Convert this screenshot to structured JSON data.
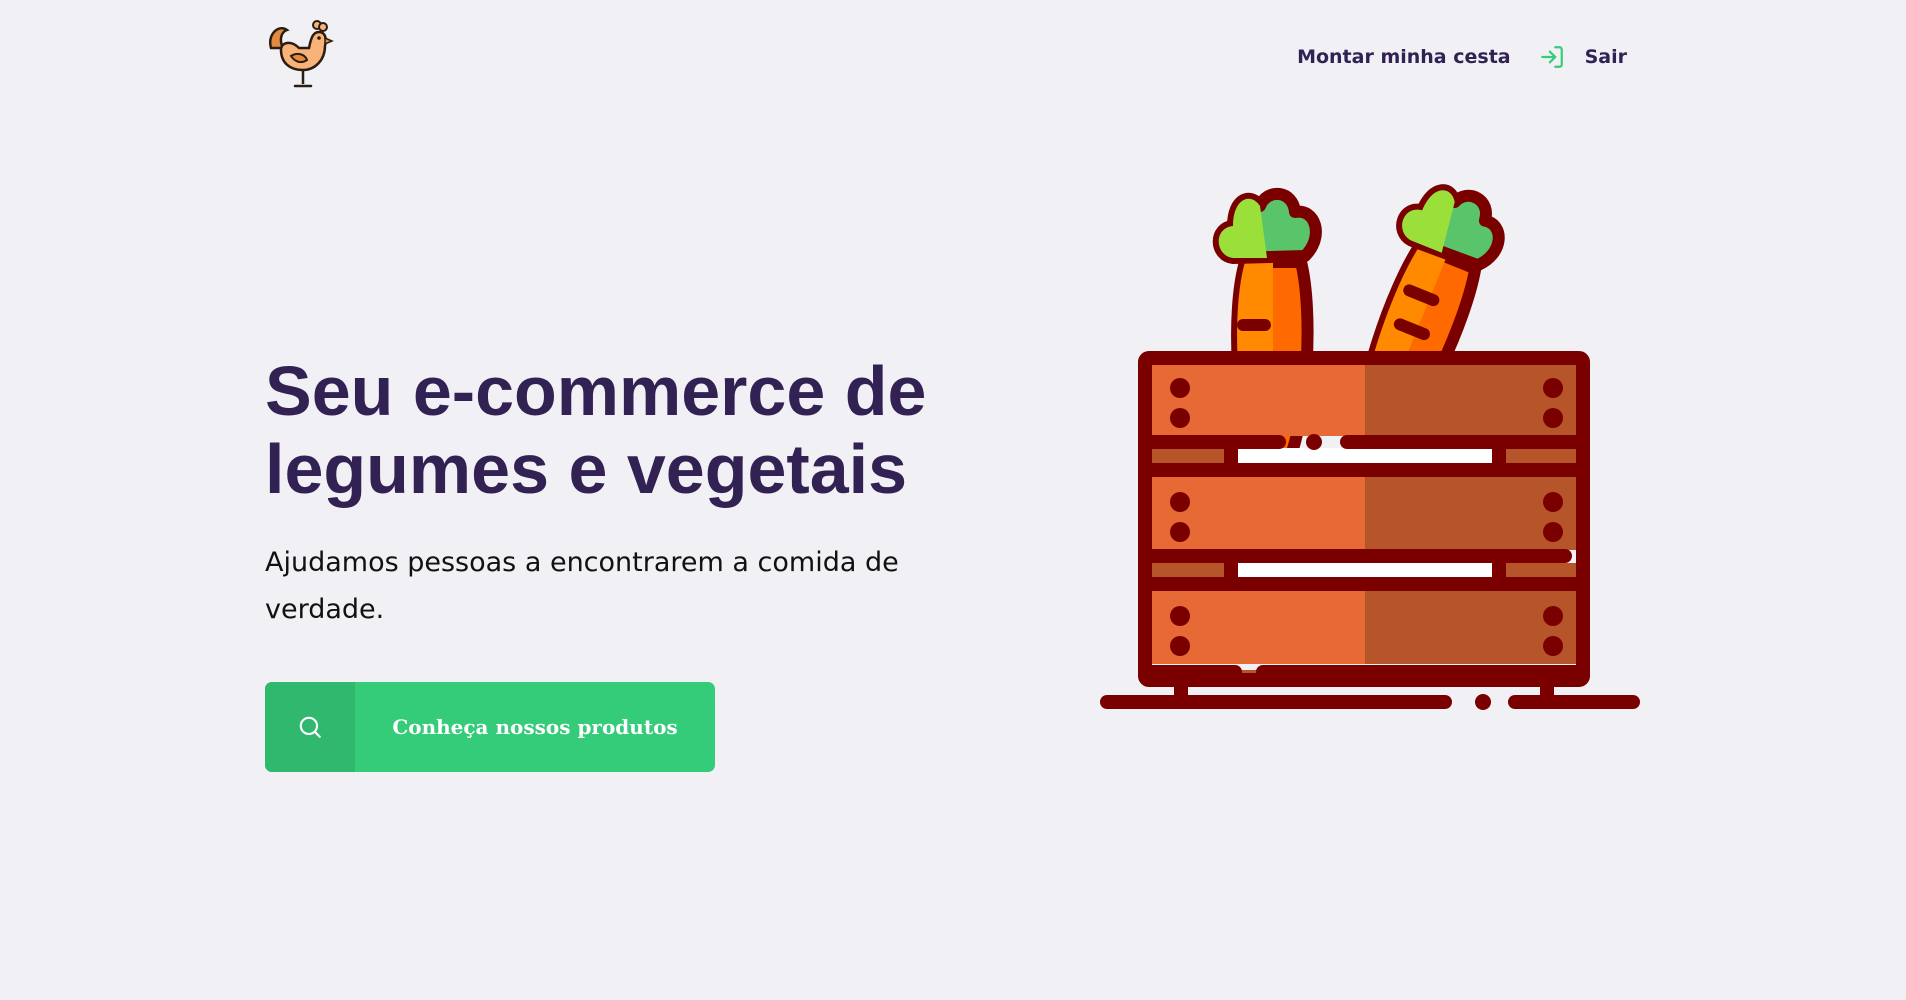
{
  "header": {
    "logo_icon": "rooster-icon",
    "nav": {
      "basket_link": "Montar minha cesta",
      "logout_icon": "log-in-icon",
      "logout_label": "Sair"
    }
  },
  "hero": {
    "title": "Seu e-commerce de legumes e vegetais",
    "subtitle": "Ajudamos pessoas a encontrarem a comida de verdade.",
    "cta": {
      "icon": "search-icon",
      "label": "Conheça nossos produtos"
    },
    "illustration_icon": "carrot-crate-icon"
  },
  "colors": {
    "background": "#f0f0f5",
    "title": "#322153",
    "accent": "#34cb79",
    "accent_dark": "#2fb86e",
    "crate_light": "#e76a36",
    "crate_dark": "#b7552a",
    "crate_outline": "#7a0000"
  }
}
